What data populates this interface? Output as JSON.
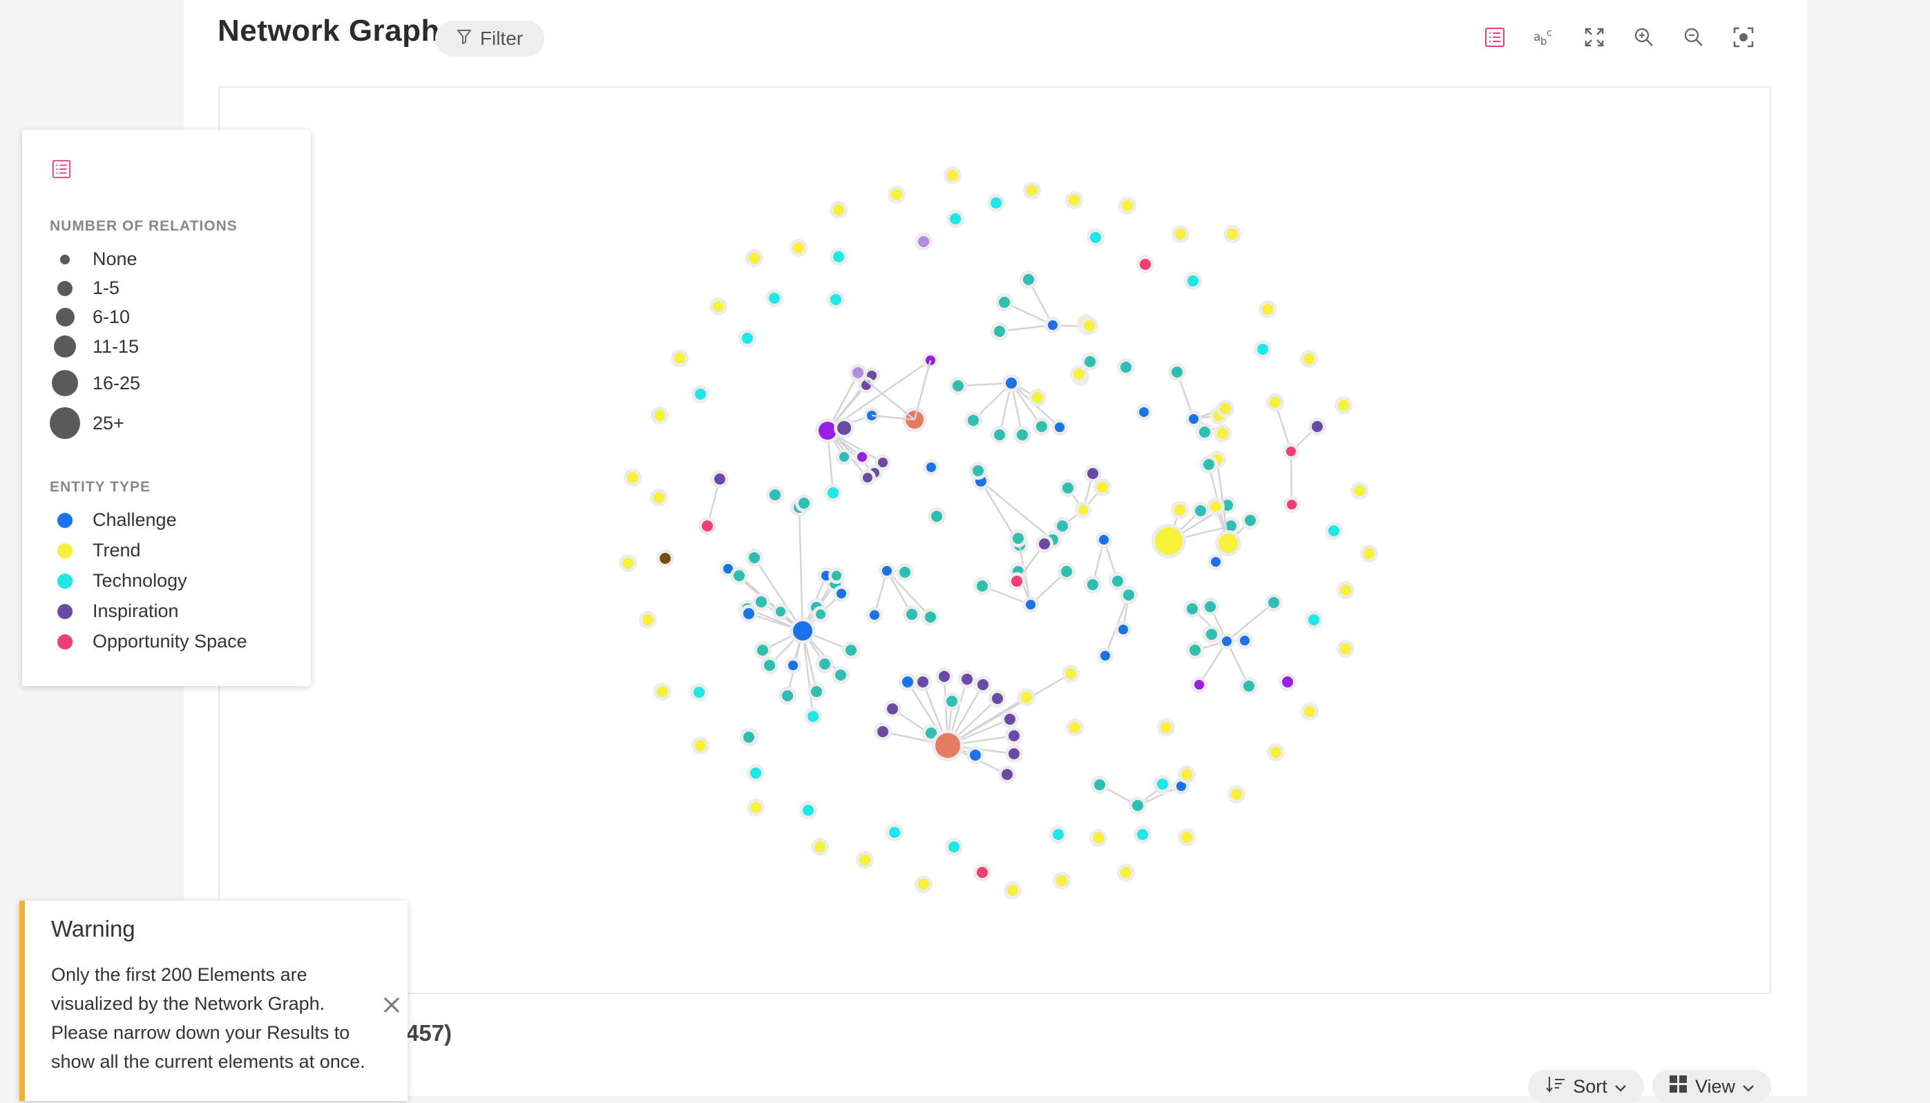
{
  "header": {
    "title": "Network Graph",
    "filter_label": "Filter"
  },
  "toolbar": [
    "list-legend-icon",
    "text-labels-icon",
    "fullscreen-icon",
    "zoom-in-icon",
    "zoom-out-icon",
    "fit-view-icon"
  ],
  "legend": {
    "relations_heading": "NUMBER OF RELATIONS",
    "relations": [
      "None",
      "1-5",
      "6-10",
      "11-15",
      "16-25",
      "25+"
    ],
    "entity_heading": "ENTITY TYPE",
    "entities": [
      {
        "label": "Challenge",
        "color": "#1a73e8"
      },
      {
        "label": "Trend",
        "color": "#f7f13a"
      },
      {
        "label": "Technology",
        "color": "#1ce8e8"
      },
      {
        "label": "Inspiration",
        "color": "#6a4aa5"
      },
      {
        "label": "Opportunity Space",
        "color": "#ef3f72"
      }
    ]
  },
  "colors": {
    "challenge": "#1a73e8",
    "trend": "#f7f13a",
    "technology": "#1ce8e8",
    "technology_alt": "#2fbfb0",
    "inspiration": "#6a4aa5",
    "opportunity": "#ef3f72",
    "other_purple": "#9b1ee6",
    "other_orange": "#e57b60",
    "accent": "#e63f7c",
    "warning": "#f2b22c"
  },
  "warning": {
    "title": "Warning",
    "message": "Only the first 200 Elements are visualized by the Network Graph. Please narrow down your Results to show all the current elements at once."
  },
  "results": {
    "count_fragment": "457)"
  },
  "actions": {
    "sort_label": "Sort",
    "view_label": "View"
  }
}
